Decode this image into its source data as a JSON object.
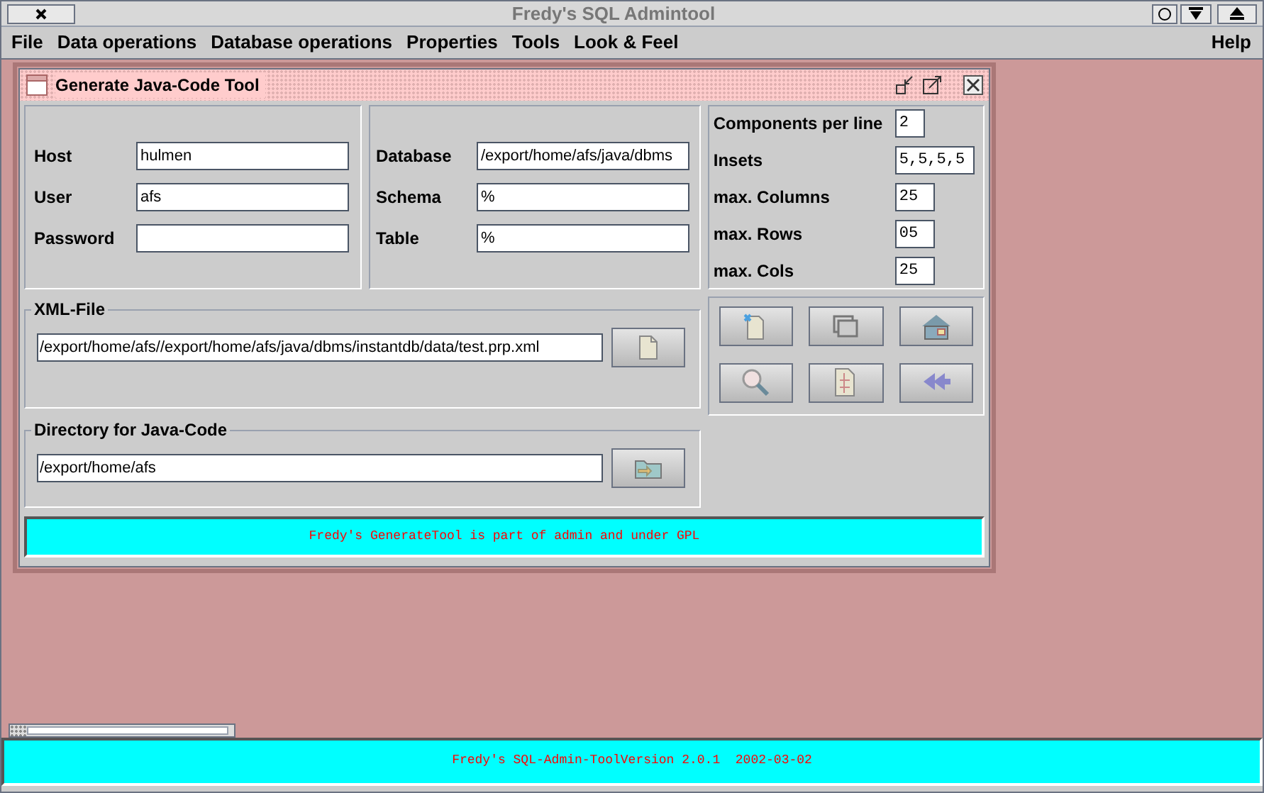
{
  "window": {
    "title": "Fredy's SQL Admintool"
  },
  "menu": {
    "items": [
      "File",
      "Data operations",
      "Database operations",
      "Properties",
      "Tools",
      "Look & Feel"
    ],
    "help": "Help"
  },
  "frame": {
    "title": "Generate Java-Code Tool"
  },
  "connection": [
    {
      "label": "Host",
      "value": "hulmen"
    },
    {
      "label": "User",
      "value": "afs"
    },
    {
      "label": "Password"
    }
  ],
  "database": [
    {
      "label": "Database",
      "value": "/export/home/afs/java/dbms"
    },
    {
      "label": "Schema",
      "value": "%"
    },
    {
      "label": "Table",
      "value": "%"
    }
  ],
  "layout": [
    {
      "label": "Components per line",
      "value": "2"
    },
    {
      "label": "Insets",
      "value": "5,5,5,5"
    },
    {
      "label": "max. Columns",
      "value": "25"
    },
    {
      "label": "max. Rows",
      "value": "05"
    },
    {
      "label": "max. Cols",
      "value": "25"
    }
  ],
  "xml_file": {
    "legend": "XML-File",
    "value": "/export/home/afs//export/home/afs/java/dbms/instantdb/data/test.prp.xml"
  },
  "java_dir": {
    "legend": "Directory for Java-Code",
    "value": "/export/home/afs"
  },
  "info": "Fredy's GenerateTool is part of admin and under GPL",
  "status_bar": "Fredy's SQL-Admin-ToolVersion 2.0.1  2002-03-02"
}
